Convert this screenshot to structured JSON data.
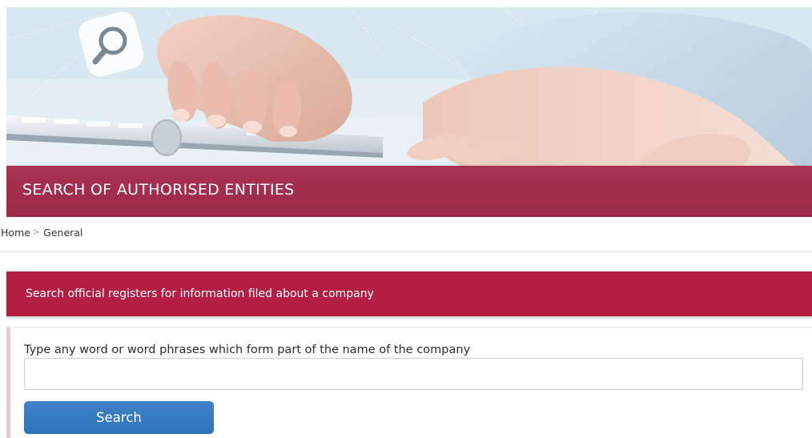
{
  "banner": {
    "title": "SEARCH OF AUTHORISED ENTITIES"
  },
  "breadcrumb": {
    "items": [
      "Home",
      "General"
    ],
    "separator": ">"
  },
  "section": {
    "title": "Search official registers for information filed about a company"
  },
  "form": {
    "label": "Type any word or word phrases which form part of the name of the company",
    "input_value": "",
    "placeholder": "",
    "button_label": "Search"
  },
  "colors": {
    "banner": "#9f2d4b",
    "section_header": "#b21f43",
    "button": "#3478bd",
    "panel_accent": "#f1c9d3"
  },
  "icons": {
    "hero_overlay": "search-magnifier-icon"
  }
}
